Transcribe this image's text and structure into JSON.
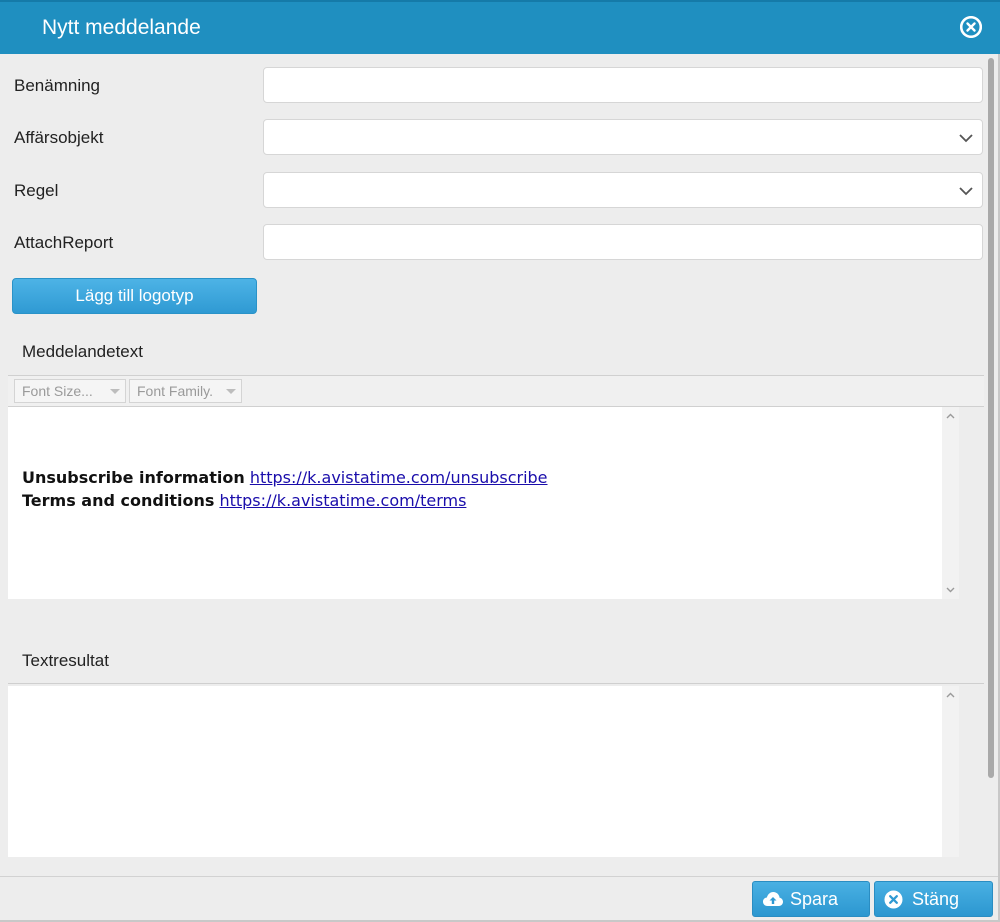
{
  "dialog": {
    "title": "Nytt meddelande"
  },
  "form": {
    "name_label": "Benämning",
    "name_value": "",
    "business_object_label": "Affärsobjekt",
    "business_object_value": "",
    "rule_label": "Regel",
    "rule_value": "",
    "attach_report_label": "AttachReport",
    "attach_report_value": "",
    "add_logo_label": "Lägg till logotyp"
  },
  "message_section": {
    "label": "Meddelandetext",
    "toolbar": {
      "font_size_placeholder": "Font Size...",
      "font_family_placeholder": "Font Family."
    },
    "body": {
      "unsubscribe_label": "Unsubscribe information",
      "unsubscribe_link": "https://k.avistatime.com/unsubscribe",
      "terms_label": "Terms and conditions",
      "terms_link": "https://k.avistatime.com/terms"
    }
  },
  "result_section": {
    "label": "Textresultat",
    "value": ""
  },
  "footer": {
    "save_label": "Spara",
    "close_label": "Stäng"
  },
  "colors": {
    "titlebar": "#1f8fc0",
    "button": "#2f9ad3",
    "link": "#1a0dab"
  }
}
